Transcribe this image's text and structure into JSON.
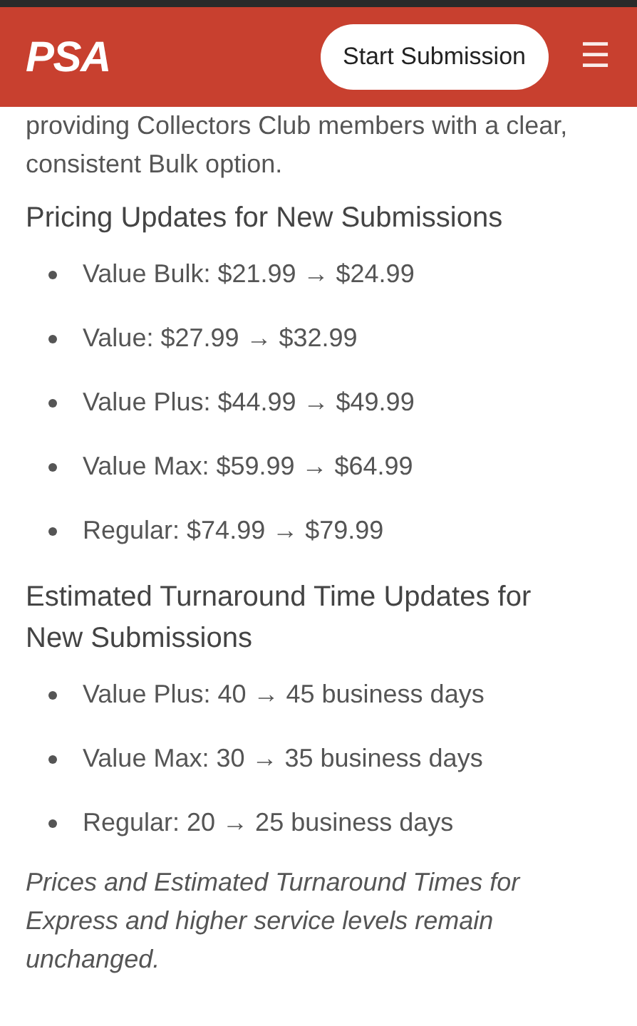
{
  "header": {
    "logo": "PSA",
    "button": "Start Submission",
    "menu": "☰"
  },
  "intro": "providing Collectors Club members with a clear, consistent Bulk option.",
  "sections": [
    {
      "heading": "Pricing Updates for New Submissions",
      "items": [
        "Value Bulk: $21.99 → $24.99",
        "Value: $27.99 → $32.99",
        "Value Plus: $44.99 → $49.99",
        "Value Max: $59.99 → $64.99",
        "Regular: $74.99 → $79.99"
      ]
    },
    {
      "heading": "Estimated Turnaround Time Updates for New Submissions",
      "items": [
        "Value Plus: 40 → 45 business days",
        "Value Max: 30 → 35 business days",
        "Regular: 20 → 25 business days"
      ]
    }
  ],
  "note": "Prices and Estimated Turnaround Times for Express and higher service levels remain unchanged."
}
